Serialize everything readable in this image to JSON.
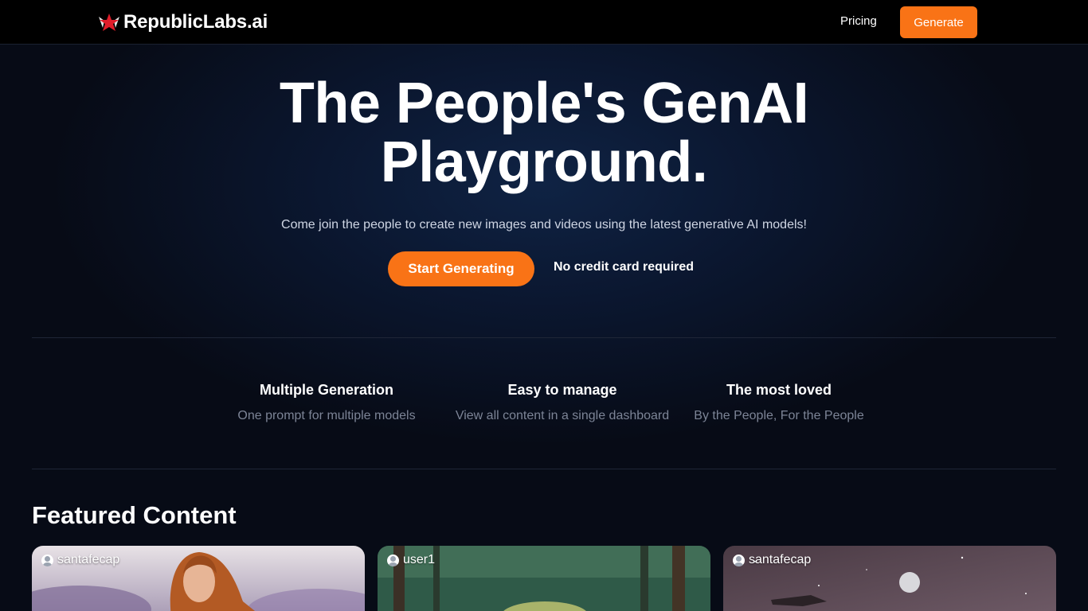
{
  "header": {
    "logo_text": "RepublicLabs.ai",
    "logo_icon": "star-wings-icon",
    "pricing": "Pricing",
    "generate": "Generate"
  },
  "hero": {
    "title_line1": "The People's GenAI",
    "title_line2": "Playground.",
    "subtitle": "Come join the people to create new images and videos using the latest generative AI models!",
    "cta": "Start Generating",
    "note": "No credit card required"
  },
  "features": [
    {
      "title": "Multiple Generation",
      "desc": "One prompt for multiple models"
    },
    {
      "title": "Easy to manage",
      "desc": "View all content in a single dashboard"
    },
    {
      "title": "The most loved",
      "desc": "By the People, For the People"
    }
  ],
  "featured": {
    "heading": "Featured Content",
    "cards": [
      {
        "user": "santafecap",
        "image": "woman-in-lavender-field"
      },
      {
        "user": "user1",
        "image": "forest-creature"
      },
      {
        "user": "santafecap",
        "image": "spaceship-and-moon"
      }
    ]
  },
  "colors": {
    "accent": "#f97316",
    "background": "#070b16",
    "header_bg": "#000000"
  }
}
